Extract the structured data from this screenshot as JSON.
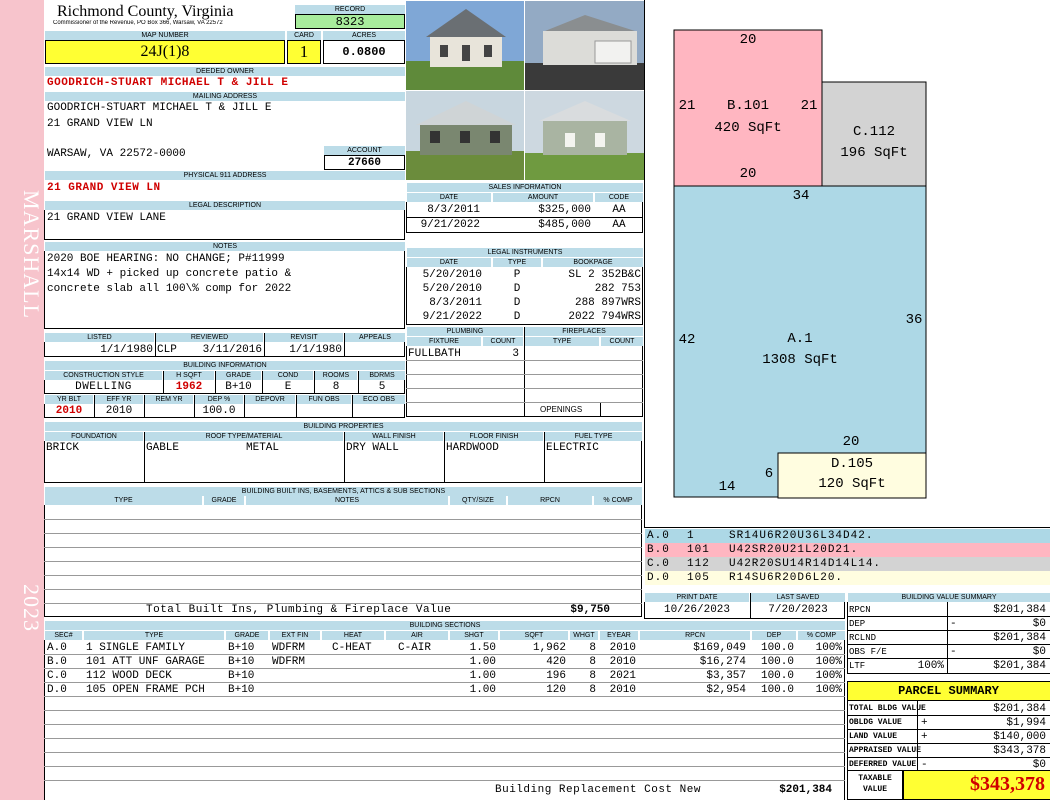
{
  "side": {
    "district": "MARSHALL",
    "year": "2023"
  },
  "header": {
    "county": "Richmond County, Virginia",
    "subtitle": "Commissioner of the Revenue, PO Box 366, Warsaw, VA 22572",
    "record_label": "RECORD",
    "record": "8323",
    "map_label": "MAP NUMBER",
    "map_number": "24J(1)8",
    "card_label": "CARD",
    "card": "1",
    "acres_label": "ACRES",
    "acres": "0.0800"
  },
  "owner": {
    "deeded_label": "DEEDED OWNER",
    "deeded": "GOODRICH-STUART MICHAEL T & JILL E",
    "mailing_label": "MAILING ADDRESS",
    "mail1": "GOODRICH-STUART MICHAEL T & JILL E",
    "mail2": "21 GRAND VIEW LN",
    "mail3": "WARSAW, VA 22572-0000",
    "account_label": "ACCOUNT",
    "account": "27660",
    "physical_label": "PHYSICAL 911 ADDRESS",
    "physical": "21 GRAND VIEW LN",
    "legal_label": "LEGAL DESCRIPTION",
    "legal": "21 GRAND VIEW LANE",
    "notes_label": "NOTES",
    "notes1": "2020 BOE HEARING: NO CHANGE; P#11999",
    "notes2": "14x14 WD + picked up concrete patio &",
    "notes3": "concrete slab all 100\\% comp for 2022"
  },
  "dates": {
    "listed_label": "LISTED",
    "listed": "1/1/1980",
    "reviewed_label": "REVIEWED",
    "reviewer": "CLP",
    "reviewed": "3/11/2016",
    "revisit_label": "REVISIT",
    "revisit": "1/1/1980",
    "appeals_label": "APPEALS"
  },
  "building": {
    "label": "BUILDING INFORMATION",
    "style_label": "CONSTRUCTION STYLE",
    "style": "DWELLING",
    "hsqft_label": "H SQFT",
    "hsqft": "1962",
    "grade_label": "GRADE",
    "grade": "B+10",
    "cond_label": "COND",
    "cond": "E",
    "rooms_label": "ROOMS",
    "rooms": "8",
    "bdrms_label": "BDRMS",
    "bdrms": "5",
    "yrblt_label": "YR BLT",
    "yrblt": "2010",
    "effyr_label": "EFF YR",
    "effyr": "2010",
    "remyr_label": "REM YR",
    "remyr": "",
    "dep_label": "DEP %",
    "dep": "100.0",
    "depovr_label": "DEPOVR",
    "funobs_label": "FUN OBS",
    "ecoobs_label": "ECO OBS"
  },
  "sales": {
    "label": "SALES INFORMATION",
    "cols": [
      "DATE",
      "AMOUNT",
      "CODE"
    ],
    "rows": [
      {
        "date": "8/3/2011",
        "amount": "$325,000",
        "code": "AA"
      },
      {
        "date": "9/21/2022",
        "amount": "$485,000",
        "code": "AA"
      }
    ]
  },
  "instruments": {
    "label": "LEGAL INSTRUMENTS",
    "cols": [
      "DATE",
      "TYPE",
      "BOOKPAGE"
    ],
    "rows": [
      {
        "date": "5/20/2010",
        "type": "P",
        "book": "SL 2 352B&C"
      },
      {
        "date": "5/20/2010",
        "type": "D",
        "book": "282 753"
      },
      {
        "date": "8/3/2011",
        "type": "D",
        "book": "288 897WRS"
      },
      {
        "date": "9/21/2022",
        "type": "D",
        "book": "2022 794WRS"
      }
    ]
  },
  "plumbing": {
    "label": "PLUMBING",
    "fixture_label": "FIXTURE",
    "count_label": "COUNT",
    "fixture": "FULLBATH",
    "count": "3"
  },
  "fireplaces": {
    "label": "FIREPLACES",
    "type_label": "TYPE",
    "count_label": "COUNT",
    "openings_label": "OPENINGS"
  },
  "properties": {
    "label": "BUILDING PROPERTIES",
    "foundation_label": "FOUNDATION",
    "foundation": "BRICK",
    "roof_label": "ROOF TYPE/MATERIAL",
    "roof_type": "GABLE",
    "roof_mat": "METAL",
    "wall_label": "WALL FINISH",
    "wall": "DRY WALL",
    "floor_label": "FLOOR FINISH",
    "floor": "HARDWOOD",
    "fuel_label": "FUEL TYPE",
    "fuel": "ELECTRIC"
  },
  "builtins": {
    "label": "BUILDING BUILT INS, BASEMENTS, ATTICS & SUB SECTIONS",
    "cols": [
      "TYPE",
      "GRADE",
      "NOTES",
      "QTY/SIZE",
      "RPCN",
      "% COMP"
    ],
    "total_label": "Total Built Ins, Plumbing & Fireplace Value",
    "total": "$9,750"
  },
  "print": {
    "print_label": "PRINT DATE",
    "print_date": "10/26/2023",
    "saved_label": "LAST SAVED",
    "saved_date": "7/20/2023"
  },
  "sections": {
    "label": "BUILDING SECTIONS",
    "cols": [
      "SEC#",
      "TYPE",
      "GRADE",
      "EXT FIN",
      "HEAT",
      "AIR",
      "SHGT",
      "SQFT",
      "WHGT",
      "EYEAR",
      "RPCN",
      "DEP",
      "% COMP"
    ],
    "rows": [
      {
        "sec": "A.0",
        "type": "1 SINGLE FAMILY",
        "grade": "B+10",
        "ext": "WDFRM",
        "heat": "C-HEAT",
        "air": "C-AIR",
        "shgt": "1.50",
        "sqft": "1,962",
        "whgt": "8",
        "eyear": "2010",
        "rpcn": "$169,049",
        "dep": "100.0",
        "comp": "100%"
      },
      {
        "sec": "B.0",
        "type": "101 ATT UNF GARAGE",
        "grade": "B+10",
        "ext": "WDFRM",
        "heat": "",
        "air": "",
        "shgt": "1.00",
        "sqft": "420",
        "whgt": "8",
        "eyear": "2010",
        "rpcn": "$16,274",
        "dep": "100.0",
        "comp": "100%"
      },
      {
        "sec": "C.0",
        "type": "112 WOOD DECK",
        "grade": "B+10",
        "ext": "",
        "heat": "",
        "air": "",
        "shgt": "1.00",
        "sqft": "196",
        "whgt": "8",
        "eyear": "2021",
        "rpcn": "$3,357",
        "dep": "100.0",
        "comp": "100%"
      },
      {
        "sec": "D.0",
        "type": "105 OPEN FRAME PCH",
        "grade": "B+10",
        "ext": "",
        "heat": "",
        "air": "",
        "shgt": "1.00",
        "sqft": "120",
        "whgt": "8",
        "eyear": "2010",
        "rpcn": "$2,954",
        "dep": "100.0",
        "comp": "100%"
      }
    ],
    "brcn_label": "Building Replacement Cost New",
    "brcn": "$201,384"
  },
  "sketch": {
    "b_label": "B.101",
    "b_sqft": "420 SqFt",
    "c_label": "C.112",
    "c_sqft": "196 SqFt",
    "a_label": "A.1",
    "a_sqft": "1308 SqFt",
    "d_label": "D.105",
    "d_sqft": "120 SqFt",
    "dims": [
      "20",
      "21",
      "21",
      "20",
      "34",
      "42",
      "36",
      "20",
      "14",
      "6"
    ],
    "colors": {
      "a": "#add8e6",
      "b": "#ffb6c1",
      "c": "#d3d3d3",
      "d": "#fffde0"
    }
  },
  "legend": [
    {
      "sec": "A.0",
      "code": "1",
      "path": "SR14U6R20U36L34D42.",
      "color": "#add8e6"
    },
    {
      "sec": "B.0",
      "code": "101",
      "path": "U42SR20U21L20D21.",
      "color": "#ffb6c1"
    },
    {
      "sec": "C.0",
      "code": "112",
      "path": "U42R20SU14R14D14L14.",
      "color": "#d3d3d3"
    },
    {
      "sec": "D.0",
      "code": "105",
      "path": "R14SU6R20D6L20.",
      "color": "#fffde0"
    }
  ],
  "value_summary": {
    "label": "BUILDING VALUE SUMMARY",
    "rpcn_label": "RPCN",
    "rpcn": "$201,384",
    "dep_label": "DEP",
    "dep_sign": "-",
    "dep": "$0",
    "rcl_label": "RCLND",
    "rcl": "$201,384",
    "obs_label": "OBS F/E",
    "obs_sign": "-",
    "obs": "$0",
    "ltf_label": "LTF",
    "ltf_pct": "100%",
    "ltf": "$201,384"
  },
  "parcel": {
    "title": "PARCEL SUMMARY",
    "bldg_label": "TOTAL BLDG VALUE",
    "bldg": "$201,384",
    "obldg_label": "OBLDG VALUE",
    "obldg_sign": "+",
    "obldg": "$1,994",
    "land_label": "LAND VALUE",
    "land_sign": "+",
    "land": "$140,000",
    "appraised_label": "APPRAISED VALUE",
    "appraised": "$343,378",
    "deferred_label": "DEFERRED VALUE",
    "deferred_sign": "-",
    "deferred": "$0",
    "taxable_label1": "TAXABLE",
    "taxable_label2": "VALUE",
    "taxable": "$343,378"
  },
  "photos": [
    {
      "name": "front-photo",
      "sky": "#7fa7d6",
      "house": "#e8e4da",
      "roof": "#6a6f73",
      "ground": "#5f8a3a"
    },
    {
      "name": "side-photo",
      "sky": "#93aac4",
      "house": "#dcdcd8",
      "roof": "#8a8e90",
      "ground": "#3a3a3a"
    },
    {
      "name": "rear-photo",
      "sky": "#c8d6df",
      "house": "#7a8770",
      "roof": "#cfd4d6",
      "ground": "#6b8c3c"
    },
    {
      "name": "porch-photo",
      "sky": "#cdd8e0",
      "house": "#a9b4a2",
      "roof": "#d9dcde",
      "ground": "#6f9a40"
    }
  ]
}
